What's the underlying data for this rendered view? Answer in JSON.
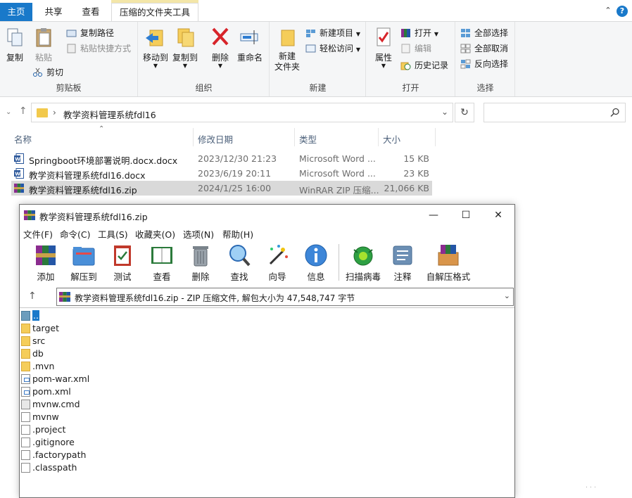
{
  "ribbon_tabs": [
    "主页",
    "共享",
    "查看",
    "压缩的文件夹工具"
  ],
  "ribbon": {
    "clipboard": {
      "label": "剪贴板",
      "copy": "复制",
      "paste": "粘贴",
      "copy_path": "复制路径",
      "paste_shortcut": "粘贴快捷方式",
      "cut": "剪切"
    },
    "organize": {
      "label": "组织",
      "move_to": "移动到",
      "copy_to": "复制到",
      "delete": "删除",
      "rename": "重命名"
    },
    "new": {
      "label": "新建",
      "new_folder": "新建\n文件夹",
      "new_item": "新建项目",
      "easy_access": "轻松访问"
    },
    "open": {
      "label": "打开",
      "properties": "属性",
      "open": "打开",
      "edit": "编辑",
      "history": "历史记录"
    },
    "select": {
      "label": "选择",
      "select_all": "全部选择",
      "select_none": "全部取消",
      "invert": "反向选择"
    }
  },
  "address": {
    "path": "教学资料管理系统fdl16",
    "search_placeholder": ""
  },
  "columns": {
    "name": "名称",
    "date": "修改日期",
    "type": "类型",
    "size": "大小"
  },
  "files": [
    {
      "name": "Springboot环境部署说明.docx.docx",
      "date": "2023/12/30 21:23",
      "type": "Microsoft Word ...",
      "size": "15 KB",
      "icon": "word-icon"
    },
    {
      "name": "教学资料管理系统fdl16.docx",
      "date": "2023/6/19 20:11",
      "type": "Microsoft Word ...",
      "size": "23 KB",
      "icon": "word-icon"
    },
    {
      "name": "教学资料管理系统fdl16.zip",
      "date": "2024/1/25 16:00",
      "type": "WinRAR ZIP 压缩...",
      "size": "21,066 KB",
      "icon": "winrar-icon",
      "selected": true
    }
  ],
  "rar": {
    "title": "教学资料管理系统fdl16.zip",
    "menu": [
      "文件(F)",
      "命令(C)",
      "工具(S)",
      "收藏夹(O)",
      "选项(N)",
      "帮助(H)"
    ],
    "toolbar": [
      "添加",
      "解压到",
      "测试",
      "查看",
      "删除",
      "查找",
      "向导",
      "信息",
      "扫描病毒",
      "注释",
      "自解压格式"
    ],
    "path": "教学资料管理系统fdl16.zip - ZIP 压缩文件, 解包大小为 47,548,747 字节",
    "entries": [
      {
        "name": "..",
        "kind": "up"
      },
      {
        "name": "target",
        "kind": "folder"
      },
      {
        "name": "src",
        "kind": "folder"
      },
      {
        "name": "db",
        "kind": "folder"
      },
      {
        "name": ".mvn",
        "kind": "folder"
      },
      {
        "name": "pom-war.xml",
        "kind": "xml"
      },
      {
        "name": "pom.xml",
        "kind": "xml"
      },
      {
        "name": "mvnw.cmd",
        "kind": "cmd"
      },
      {
        "name": "mvnw",
        "kind": "file"
      },
      {
        "name": ".project",
        "kind": "file"
      },
      {
        "name": ".gitignore",
        "kind": "file"
      },
      {
        "name": ".factorypath",
        "kind": "file"
      },
      {
        "name": ".classpath",
        "kind": "file"
      }
    ]
  },
  "colors": {
    "accent": "#1979ca",
    "selection": "#d9d9d9",
    "folder": "#f5cd5a"
  }
}
